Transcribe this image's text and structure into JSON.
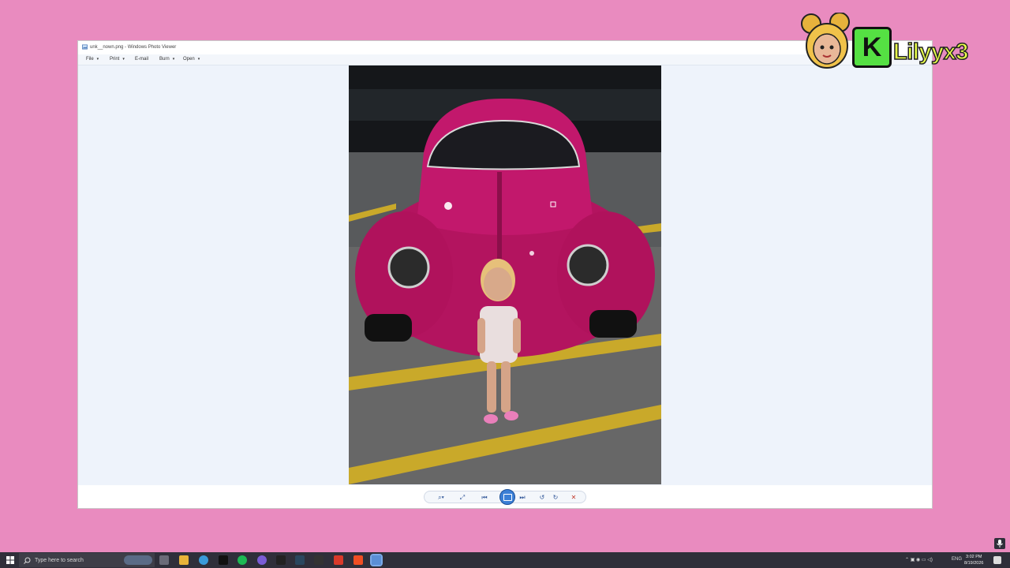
{
  "window": {
    "title": "unk__nown.png - Windows Photo Viewer"
  },
  "menu": {
    "items": [
      {
        "label": "File",
        "caret": "▾"
      },
      {
        "label": "Print",
        "caret": "▾"
      },
      {
        "label": "E-mail",
        "caret": ""
      },
      {
        "label": "Burn",
        "caret": "▾"
      },
      {
        "label": "Open",
        "caret": "▾"
      }
    ]
  },
  "controls": {
    "zoom": "⌕▾",
    "fit": "⤢",
    "prev": "⏮",
    "next": "⏭",
    "rotate_ccw": "↺",
    "rotate_cw": "↻",
    "delete": "✕"
  },
  "overlay": {
    "badge": "K",
    "name": "Lilyyx3"
  },
  "taskbar": {
    "search_placeholder": "Type here to search",
    "language": "ENG",
    "time": "3:02 PM",
    "date": "8/19/2026"
  },
  "colors": {
    "background": "#e98bbf",
    "car": "#c0196e",
    "accent": "#3b7fd6"
  }
}
